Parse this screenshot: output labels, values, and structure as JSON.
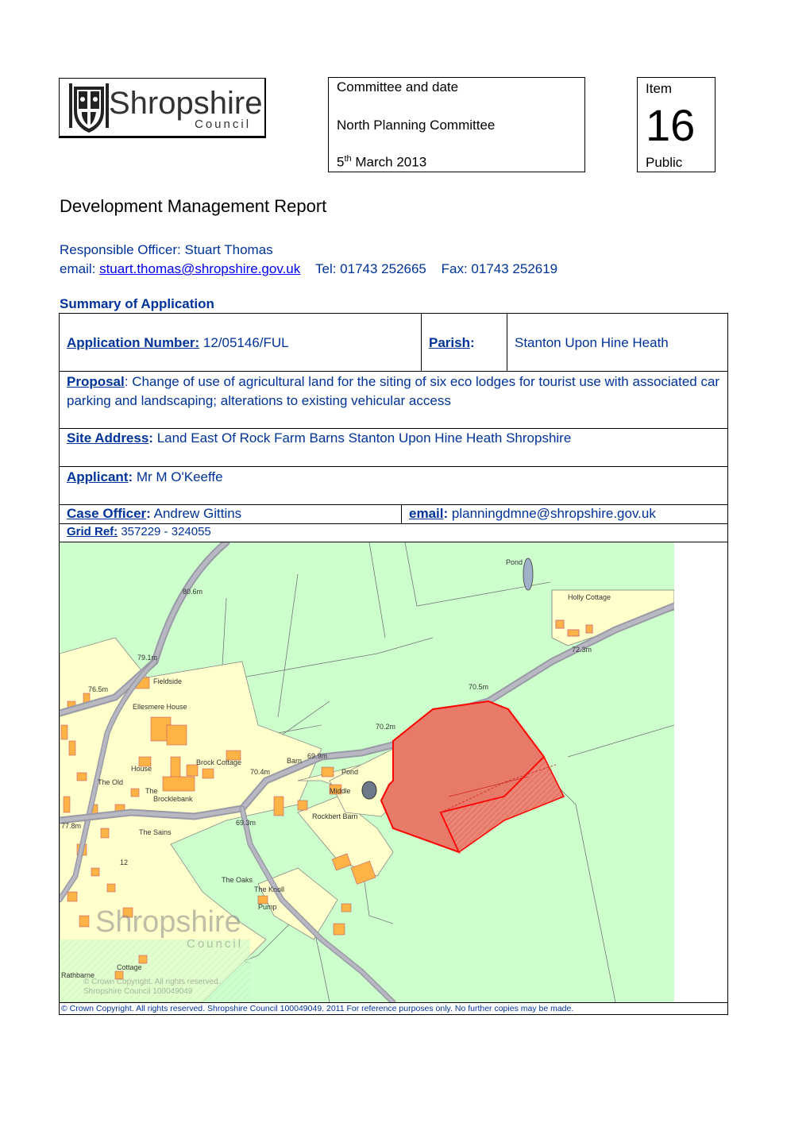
{
  "logo": {
    "name": "Shropshire",
    "sub": "Council"
  },
  "committee": {
    "heading": "Committee and date",
    "name": "North Planning Committee",
    "date_day": "5",
    "date_sup": "th",
    "date_rest": " March 2013"
  },
  "item": {
    "label": "Item",
    "number": "16",
    "status": "Public"
  },
  "title": "Development Management Report",
  "officer": {
    "line": "Responsible Officer: Stuart Thomas",
    "email_label": "email: ",
    "email": "stuart.thomas@shropshire.gov.uk",
    "tel": "Tel: 01743 252665",
    "fax": "Fax: 01743 252619"
  },
  "summary_heading": "Summary of Application",
  "application": {
    "number_label": "Application Number:",
    "number": " 12/05146/FUL",
    "parish_label": "Parish",
    "parish_colon": ":",
    "parish": "Stanton Upon Hine Heath",
    "proposal_label": "Proposal",
    "proposal": ": Change of use of agricultural land for the siting of six eco lodges for tourist use with associated car parking and landscaping; alterations to existing vehicular access",
    "site_label": "Site Address",
    "site_colon": ":",
    "site": " Land East Of Rock Farm Barns Stanton Upon Hine Heath Shropshire",
    "applicant_label": "Applicant",
    "applicant_colon": ":",
    "applicant": " Mr M O'Keeffe",
    "case_label": "Case Officer",
    "case_colon": ":",
    "case_officer": " Andrew Gittins",
    "email_label": "email",
    "email_colon": ":",
    "email": " planningdmne@shropshire.gov.uk",
    "grid_label": "Grid Ref:",
    "grid": " 357229 - 324055"
  },
  "map": {
    "labels": [
      "Pond",
      "80.6m",
      "Holly Cottage",
      "72.3m",
      "79.1m",
      "Fieldside",
      "76.5m",
      "70.5m",
      "Ellesmere House",
      "70.2m",
      "Barn",
      "69.9m",
      "Brock Cottage",
      "70.4m",
      "Pond",
      "Middle",
      "House",
      "The Old",
      "The",
      "Brocklebank",
      "Rockbert Barn",
      "69.3m",
      "The Sains",
      "12",
      "The Oaks",
      "The Knoll",
      "Pump",
      "Cottage",
      "Rathbarne",
      "77.8m"
    ],
    "watermark": "Shropshire",
    "watermark_sub": "Council",
    "watermark_copy": "© Crown Copyright. All rights reserved.",
    "watermark_licence": "Shropshire Council 100049049",
    "colors": {
      "field": "#ccffcc",
      "plot": "#ffffcc",
      "building": "#ffb347",
      "road": "#9a9aa6",
      "site": "#e87a6a",
      "site_edge": "#ff0000"
    }
  },
  "copyright": "© Crown Copyright. All rights reserved.  Shropshire Council 100049049. 2011 For reference purposes only. No further copies may be made."
}
